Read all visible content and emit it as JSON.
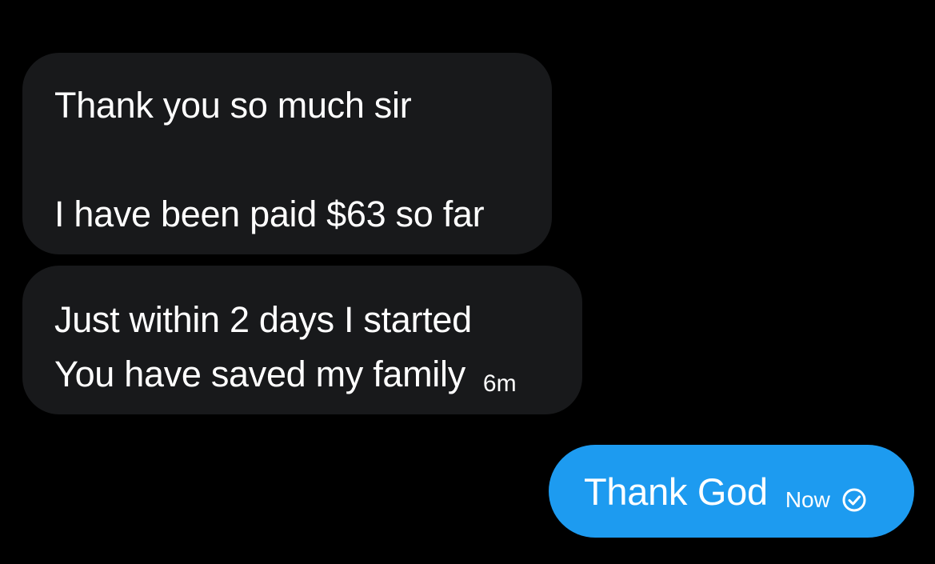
{
  "messages": {
    "incoming": [
      {
        "lines": [
          "Thank you so much sir",
          "",
          "I have been paid $63 so far"
        ]
      },
      {
        "lines": [
          "Just within 2 days I started",
          "You have saved my family"
        ],
        "time": "6m"
      }
    ],
    "outgoing": [
      {
        "text": "Thank God",
        "time": "Now",
        "status_icon": "sent-check-icon"
      }
    ]
  },
  "colors": {
    "background": "#000000",
    "incoming_bubble": "#18191b",
    "outgoing_bubble": "#1d9bf0",
    "text": "#ffffff"
  }
}
